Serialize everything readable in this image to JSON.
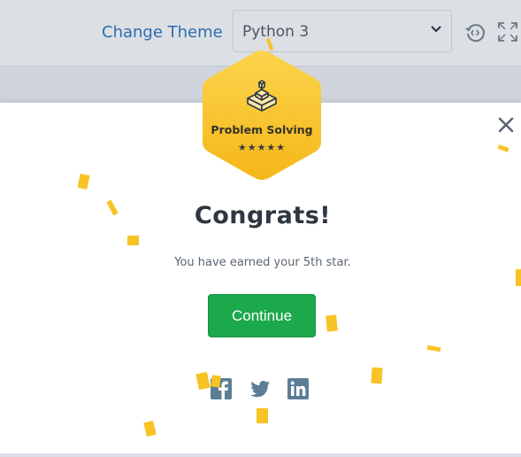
{
  "toolbar": {
    "change_theme": "Change Theme",
    "language": "Python 3",
    "icons": [
      "history-icon",
      "fullscreen-icon"
    ]
  },
  "modal": {
    "badge": {
      "title": "Problem Solving",
      "stars": "★★★★★",
      "star_count": 5,
      "color": "#f7c325"
    },
    "heading": "Congrats!",
    "message": "You have earned your 5th star.",
    "continue_label": "Continue",
    "share_icons": [
      "facebook-icon",
      "twitter-icon",
      "linkedin-icon"
    ],
    "close_icon": "close-icon"
  },
  "colors": {
    "accent": "#1ba94c",
    "confetti": "#f7c325",
    "link": "#2f6fb4",
    "social": "#5b7e94"
  }
}
